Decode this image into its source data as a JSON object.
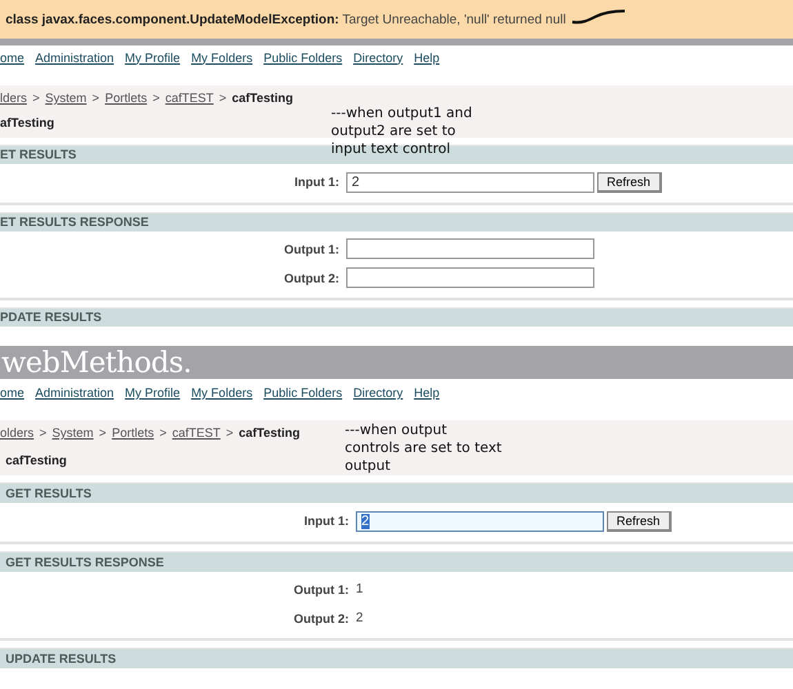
{
  "error": {
    "message": "**class javax.faces.component.UpdateModelException:** Target Unreachable, 'null' returned null"
  },
  "panels": [
    {
      "nav": [
        "ome",
        "Administration",
        "My Profile",
        "My Folders",
        "Public Folders",
        "Directory",
        "Help"
      ],
      "breadcrumb": [
        {
          "kind": "link",
          "label": "lders"
        },
        {
          "kind": "sep",
          "label": ">"
        },
        {
          "kind": "link",
          "label": "System"
        },
        {
          "kind": "sep",
          "label": ">"
        },
        {
          "kind": "link",
          "label": "Portlets"
        },
        {
          "kind": "sep",
          "label": ">"
        },
        {
          "kind": "link",
          "label": "cafTEST"
        },
        {
          "kind": "sep",
          "label": ">"
        },
        {
          "kind": "current",
          "label": "cafTesting"
        }
      ],
      "title": "afTesting",
      "note": [
        "---when output1 and",
        "output2 are set to",
        "input text control"
      ],
      "sections": [
        {
          "title": "ET RESULTS",
          "rows": [
            {
              "kind": "input",
              "label": "Input 1:",
              "value": "2",
              "focused": false,
              "button": "Refresh"
            }
          ]
        },
        {
          "title": "ET RESULTS RESPONSE",
          "rows": [
            {
              "kind": "field",
              "label": "Output 1:"
            },
            {
              "kind": "field",
              "label": "Output 2:"
            }
          ]
        },
        {
          "title": "PDATE RESULTS"
        }
      ]
    },
    {
      "logo": "webMethods.",
      "nav": [
        "ome",
        "Administration",
        "My Profile",
        "My Folders",
        "Public Folders",
        "Directory",
        "Help"
      ],
      "breadcrumb": [
        {
          "kind": "link",
          "label": "olders"
        },
        {
          "kind": "sep",
          "label": ">"
        },
        {
          "kind": "link",
          "label": "System"
        },
        {
          "kind": "sep",
          "label": ">"
        },
        {
          "kind": "link",
          "label": "Portlets"
        },
        {
          "kind": "sep",
          "label": ">"
        },
        {
          "kind": "link",
          "label": "cafTEST"
        },
        {
          "kind": "sep",
          "label": ">"
        },
        {
          "kind": "current",
          "label": "cafTesting"
        }
      ],
      "title": "cafTesting",
      "note": [
        "---when output",
        "controls are set to text",
        "output"
      ],
      "sections": [
        {
          "title": "GET RESULTS",
          "rows": [
            {
              "kind": "input",
              "label": "Input 1:",
              "value": "2",
              "focused": true,
              "button": "Refresh"
            }
          ]
        },
        {
          "title": "GET RESULTS RESPONSE",
          "rows": [
            {
              "kind": "text",
              "label": "Output 1:",
              "value": "1"
            },
            {
              "kind": "text",
              "label": "Output 2:",
              "value": "2"
            }
          ]
        },
        {
          "title": "UPDATE RESULTS"
        }
      ]
    }
  ]
}
